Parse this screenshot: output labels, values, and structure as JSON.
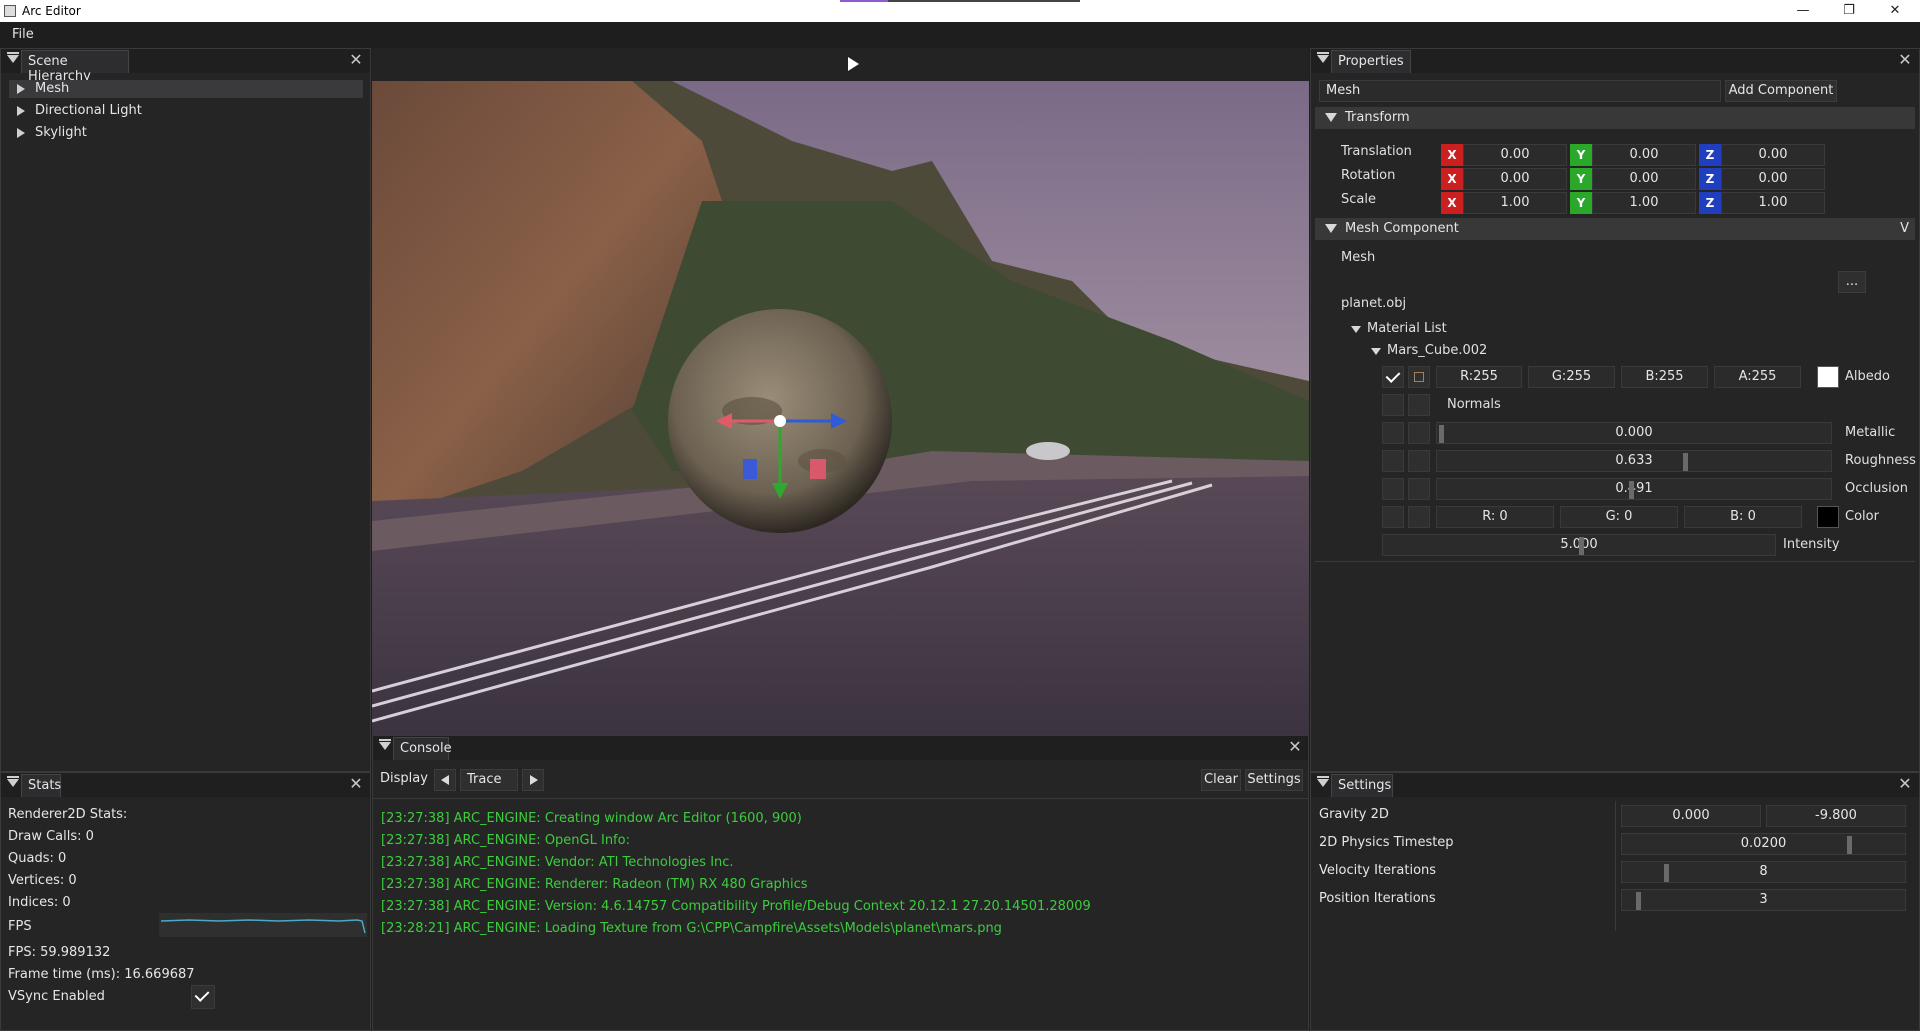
{
  "window": {
    "title": "Arc Editor"
  },
  "menu": {
    "file": "File"
  },
  "hierarchy": {
    "tab": "Scene Hierarchy",
    "items": [
      {
        "label": "Mesh"
      },
      {
        "label": "Directional Light"
      },
      {
        "label": "Skylight"
      }
    ]
  },
  "console": {
    "tab": "Console",
    "display_label": "Display",
    "level": "Trace",
    "clear": "Clear",
    "settings": "Settings",
    "lines": [
      "[23:27:38] ARC_ENGINE: Creating window Arc Editor (1600, 900)",
      "[23:27:38] ARC_ENGINE: OpenGL Info:",
      "[23:27:38] ARC_ENGINE:   Vendor: ATI Technologies Inc.",
      "[23:27:38] ARC_ENGINE:   Renderer: Radeon (TM) RX 480 Graphics",
      "[23:27:38] ARC_ENGINE:   Version: 4.6.14757 Compatibility Profile/Debug Context 20.12.1 27.20.14501.28009",
      "[23:28:21] ARC_ENGINE: Loading Texture from G:\\CPP\\Campfire\\Assets\\Models\\planet\\mars.png"
    ],
    "color": "#3dcc3d"
  },
  "stats": {
    "tab": "Stats",
    "renderer": "Renderer2D Stats:",
    "draw_calls": "Draw Calls: 0",
    "quads": "Quads: 0",
    "vertices": "Vertices: 0",
    "indices": "Indices: 0",
    "fps_label": "FPS",
    "fps": "FPS: 59.989132",
    "frame_time": "Frame time (ms): 16.669687",
    "vsync": "VSync Enabled",
    "vsync_on": true
  },
  "properties": {
    "tab": "Properties",
    "entity_name": "Mesh",
    "add_component": "Add Component",
    "transform": {
      "header": "Transform",
      "rows": [
        {
          "label": "Translation",
          "x": "0.00",
          "y": "0.00",
          "z": "0.00"
        },
        {
          "label": "Rotation",
          "x": "0.00",
          "y": "0.00",
          "z": "0.00"
        },
        {
          "label": "Scale",
          "x": "1.00",
          "y": "1.00",
          "z": "1.00"
        }
      ],
      "axis_x": "X",
      "axis_y": "Y",
      "axis_z": "Z"
    },
    "mesh_component": {
      "header": "Mesh Component",
      "menu": "V",
      "mesh_label": "Mesh",
      "browse": "...",
      "file": "planet.obj",
      "material_list": "Material List",
      "material_name": "Mars_Cube.002",
      "albedo": {
        "r": "R:255",
        "g": "G:255",
        "b": "B:255",
        "a": "A:255",
        "label": "Albedo",
        "swatch": "#ffffff"
      },
      "normals": "Normals",
      "metallic": {
        "value": "0.000",
        "label": "Metallic",
        "level": 0.0
      },
      "roughness": {
        "value": "0.633",
        "label": "Roughness",
        "level": 0.633
      },
      "occlusion": {
        "value": "0.491",
        "label": "Occlusion",
        "level": 0.491
      },
      "color": {
        "r": "R:  0",
        "g": "G:  0",
        "b": "B:  0",
        "label": "Color",
        "swatch": "#000000"
      },
      "intensity": {
        "value": "5.000",
        "label": "Intensity"
      }
    }
  },
  "settings": {
    "tab": "Settings",
    "rows": [
      {
        "label": "Gravity 2D",
        "v1": "0.000",
        "v2": "-9.800"
      },
      {
        "label": "2D Physics Timestep",
        "value": "0.0200"
      },
      {
        "label": "Velocity Iterations",
        "value": "8"
      },
      {
        "label": "Position Iterations",
        "value": "3"
      }
    ]
  },
  "colors": {
    "axis_x": "#cc1f1f",
    "axis_y": "#2aa82a",
    "axis_z": "#1f3fbf",
    "console_text": "#3dcc3d"
  }
}
